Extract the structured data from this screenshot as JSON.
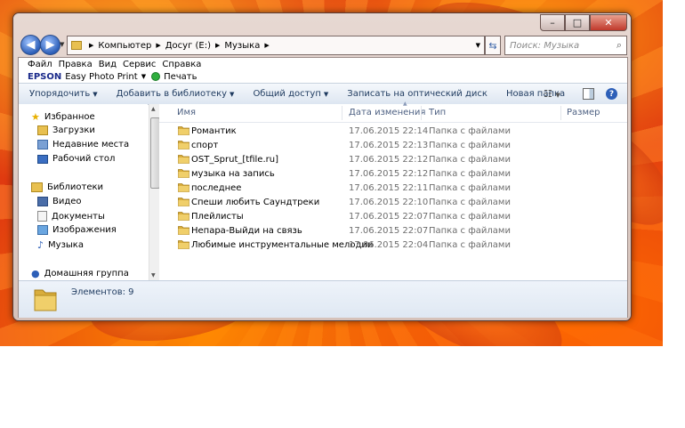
{
  "window": {
    "caption_buttons": [
      "–",
      "□",
      "✕"
    ]
  },
  "nav": {
    "breadcrumb": [
      "Компьютер",
      "Досуг (E:)",
      "Музыка"
    ],
    "search_placeholder": "Поиск: Музыка"
  },
  "menu": {
    "items": [
      "Файл",
      "Правка",
      "Вид",
      "Сервис",
      "Справка"
    ],
    "epson_brand": "EPSON",
    "epson_app": "Easy Photo Print",
    "print_label": "Печать"
  },
  "toolbar": {
    "organize": "Упорядочить",
    "add_library": "Добавить в библиотеку",
    "share": "Общий доступ",
    "burn": "Записать на оптический диск",
    "new_folder": "Новая папка"
  },
  "sidebar": {
    "favorites": "Избранное",
    "downloads": "Загрузки",
    "recent": "Недавние места",
    "desktop": "Рабочий стол",
    "libraries": "Библиотеки",
    "video": "Видео",
    "documents": "Документы",
    "images": "Изображения",
    "music": "Музыка",
    "homegroup": "Домашняя группа"
  },
  "columns": {
    "name": "Имя",
    "date": "Дата изменения",
    "type": "Тип",
    "size": "Размер"
  },
  "files": [
    {
      "name": "Романтик",
      "date": "17.06.2015 22:14",
      "type": "Папка с файлами"
    },
    {
      "name": "спорт",
      "date": "17.06.2015 22:13",
      "type": "Папка с файлами"
    },
    {
      "name": "OST_Sprut_[tfile.ru]",
      "date": "17.06.2015 22:12",
      "type": "Папка с файлами"
    },
    {
      "name": "музыка на запись",
      "date": "17.06.2015 22:12",
      "type": "Папка с файлами"
    },
    {
      "name": "последнее",
      "date": "17.06.2015 22:11",
      "type": "Папка с файлами"
    },
    {
      "name": "Спеши любить Саундтреки",
      "date": "17.06.2015 22:10",
      "type": "Папка с файлами"
    },
    {
      "name": "Плейлисты",
      "date": "17.06.2015 22:07",
      "type": "Папка с файлами"
    },
    {
      "name": "Непара-Выйди на связь",
      "date": "17.06.2015 22:07",
      "type": "Папка с файлами"
    },
    {
      "name": "Любимые инструментальные мелодии",
      "date": "17.06.2015 22:04",
      "type": "Папка с файлами"
    }
  ],
  "details": {
    "count_label": "Элементов: 9"
  },
  "colors": {
    "accent": "#2d5fb8",
    "folder": "#e8c050"
  }
}
